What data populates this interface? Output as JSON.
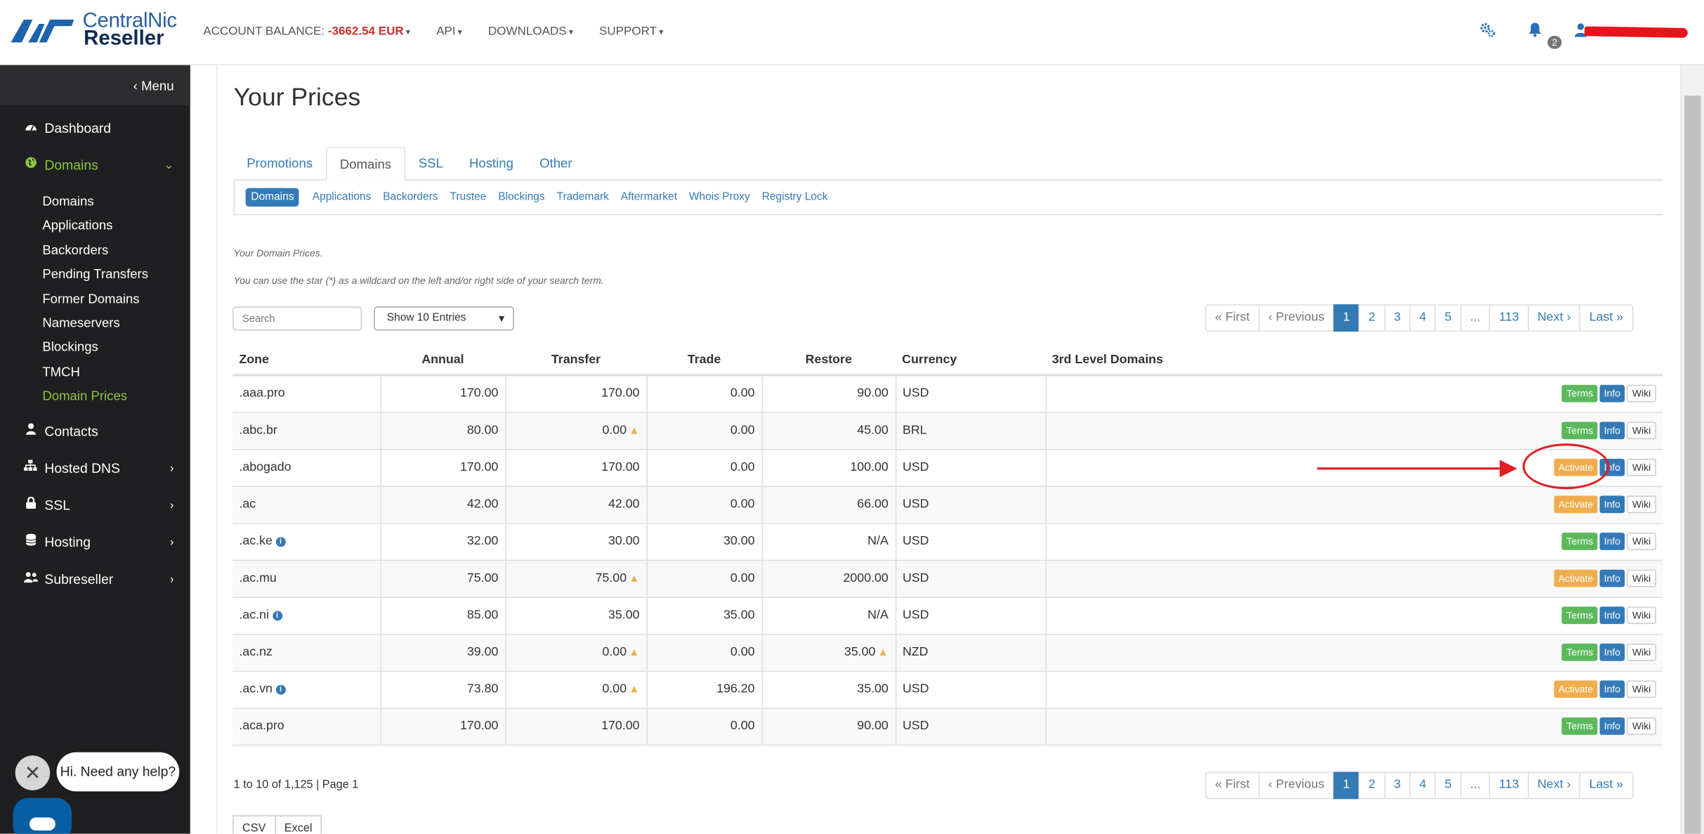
{
  "topbar": {
    "logo_line1": "CentralNic",
    "logo_line2": "Reseller",
    "balance_label": "ACCOUNT BALANCE:",
    "balance_value": "-3662.54 EUR",
    "nav": [
      "API",
      "DOWNLOADS",
      "SUPPORT"
    ],
    "notification_count": "2",
    "icons": [
      "settings-cogs-icon",
      "bell-icon",
      "user-icon"
    ]
  },
  "sidebar": {
    "menu_label": "‹ Menu",
    "items": [
      {
        "label": "Dashboard",
        "icon": "dashboard-icon"
      },
      {
        "label": "Domains",
        "icon": "globe-icon"
      },
      {
        "label": "Contacts",
        "icon": "user-icon"
      },
      {
        "label": "Hosted DNS",
        "icon": "sitemap-icon"
      },
      {
        "label": "SSL",
        "icon": "lock-icon"
      },
      {
        "label": "Hosting",
        "icon": "database-icon"
      },
      {
        "label": "Subreseller",
        "icon": "users-icon"
      }
    ],
    "domain_sub": [
      "Domains",
      "Applications",
      "Backorders",
      "Pending Transfers",
      "Former Domains",
      "Nameservers",
      "Blockings",
      "TMCH",
      "Domain Prices"
    ]
  },
  "chat": {
    "prompt": "Hi. Need any help?",
    "close": "✕"
  },
  "page": {
    "title": "Your Prices",
    "tabs": [
      "Promotions",
      "Domains",
      "SSL",
      "Hosting",
      "Other"
    ],
    "subtabs": [
      "Domains",
      "Applications",
      "Backorders",
      "Trustee",
      "Blockings",
      "Trademark",
      "Aftermarket",
      "Whois Proxy",
      "Registry Lock"
    ],
    "note1": "Your Domain Prices.",
    "note2": "You can use the star (*) as a wildcard on the left and/or right side of your search term.",
    "search_placeholder": "Search",
    "entries_select": "Show 10 Entries",
    "pager": [
      "« First",
      "‹ Previous",
      "1",
      "2",
      "3",
      "4",
      "5",
      "...",
      "113",
      "Next ›",
      "Last »"
    ],
    "summary": "1 to 10 of 1,125 | Page 1",
    "export": [
      "CSV",
      "Excel"
    ]
  },
  "table": {
    "headers": [
      "Zone",
      "Annual",
      "Transfer",
      "Trade",
      "Restore",
      "Currency",
      "3rd Level Domains"
    ],
    "rows": [
      {
        "zone": ".aaa.pro",
        "annual": "170.00",
        "transfer": "170.00",
        "trade": "0.00",
        "restore": "90.00",
        "currency": "USD",
        "action": "Terms"
      },
      {
        "zone": ".abc.br",
        "annual": "80.00",
        "transfer": "0.00",
        "trade": "0.00",
        "restore": "45.00",
        "currency": "BRL",
        "action": "Terms"
      },
      {
        "zone": ".abogado",
        "annual": "170.00",
        "transfer": "170.00",
        "trade": "0.00",
        "restore": "100.00",
        "currency": "USD",
        "action": "Activate"
      },
      {
        "zone": ".ac",
        "annual": "42.00",
        "transfer": "42.00",
        "trade": "0.00",
        "restore": "66.00",
        "currency": "USD",
        "action": "Activate"
      },
      {
        "zone": ".ac.ke",
        "annual": "32.00",
        "transfer": "30.00",
        "trade": "30.00",
        "restore": "N/A",
        "currency": "USD",
        "action": "Terms"
      },
      {
        "zone": ".ac.mu",
        "annual": "75.00",
        "transfer": "75.00",
        "trade": "0.00",
        "restore": "2000.00",
        "currency": "USD",
        "action": "Activate"
      },
      {
        "zone": ".ac.ni",
        "annual": "85.00",
        "transfer": "35.00",
        "trade": "35.00",
        "restore": "N/A",
        "currency": "USD",
        "action": "Terms"
      },
      {
        "zone": ".ac.nz",
        "annual": "39.00",
        "transfer": "0.00",
        "trade": "0.00",
        "restore": "35.00",
        "currency": "NZD",
        "action": "Terms"
      },
      {
        "zone": ".ac.vn",
        "annual": "73.80",
        "transfer": "0.00",
        "trade": "196.20",
        "restore": "35.00",
        "currency": "USD",
        "action": "Activate"
      },
      {
        "zone": ".aca.pro",
        "annual": "170.00",
        "transfer": "170.00",
        "trade": "0.00",
        "restore": "90.00",
        "currency": "USD",
        "action": "Terms"
      }
    ],
    "info_label": "Info",
    "wiki_label": "Wiki"
  },
  "colors": {
    "accent": "#337ab7",
    "active_green": "#8dc63f",
    "negative": "#c9302c",
    "terms": "#5cb85c",
    "activate": "#f0ad4e",
    "annotation": "#e31e24"
  }
}
